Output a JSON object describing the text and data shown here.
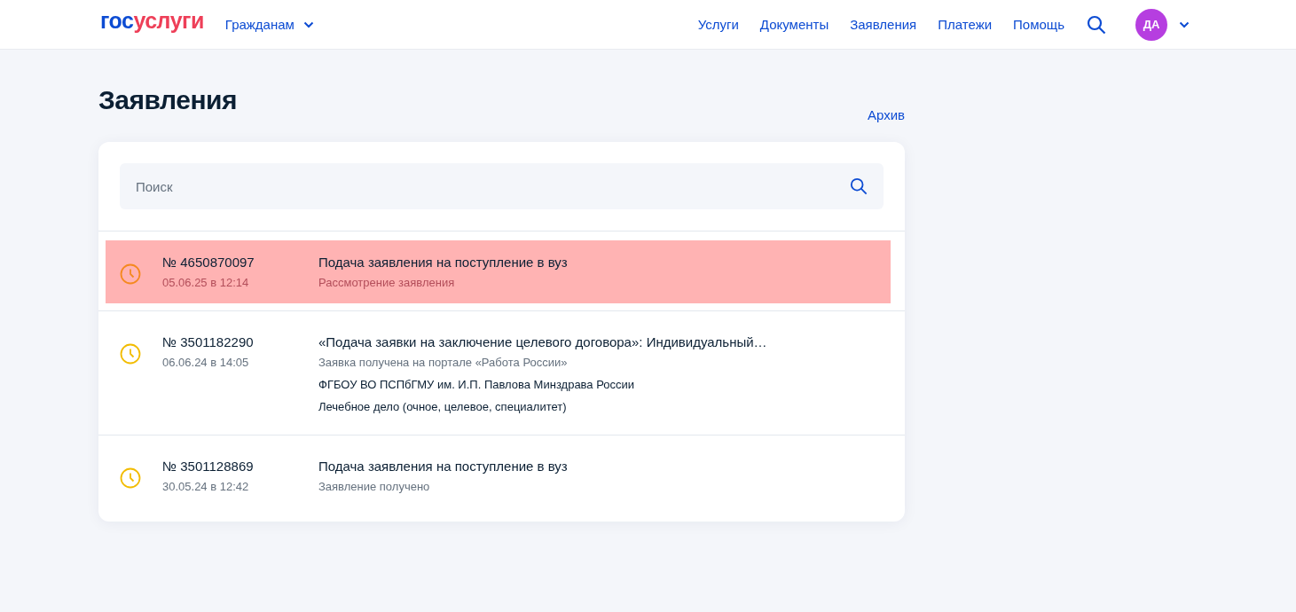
{
  "header": {
    "logo": [
      "гос",
      "услуги"
    ],
    "audience": "Гражданам",
    "nav": [
      {
        "label": "Услуги",
        "selected": false
      },
      {
        "label": "Документы",
        "selected": false
      },
      {
        "label": "Заявления",
        "selected": false
      },
      {
        "label": "Платежи",
        "selected": false
      },
      {
        "label": "Помощь",
        "selected": false
      }
    ],
    "avatar": "ДА"
  },
  "page": {
    "title": "Заявления",
    "archive_link": "Архив"
  },
  "search": {
    "placeholder": "Поиск"
  },
  "applications": [
    {
      "number": "№ 4650870097",
      "date": "05.06.25 в 12:14",
      "title": "Подача заявления на поступление в вуз",
      "status": "Рассмотрение заявления",
      "selected": true,
      "color": "#f5891f"
    },
    {
      "number": "№ 3501182290",
      "date": "06.06.24 в 14:05",
      "title": "«Подача заявки на заключение целевого договора»: Индивидуальный…",
      "status": "Заявка получена на портале «Работа России»",
      "details": [
        "ФГБОУ ВО ПСПбГМУ им. И.П. Павлова Минздрава России",
        "Лечебное дело (очное, целевое, специалитет)"
      ],
      "selected": false,
      "color": "#f2bc00"
    },
    {
      "number": "№ 3501128869",
      "date": "30.05.24 в 12:42",
      "title": "Подача заявления на поступление в вуз",
      "status": "Заявление получено",
      "selected": false,
      "color": "#f2bc00"
    }
  ]
}
